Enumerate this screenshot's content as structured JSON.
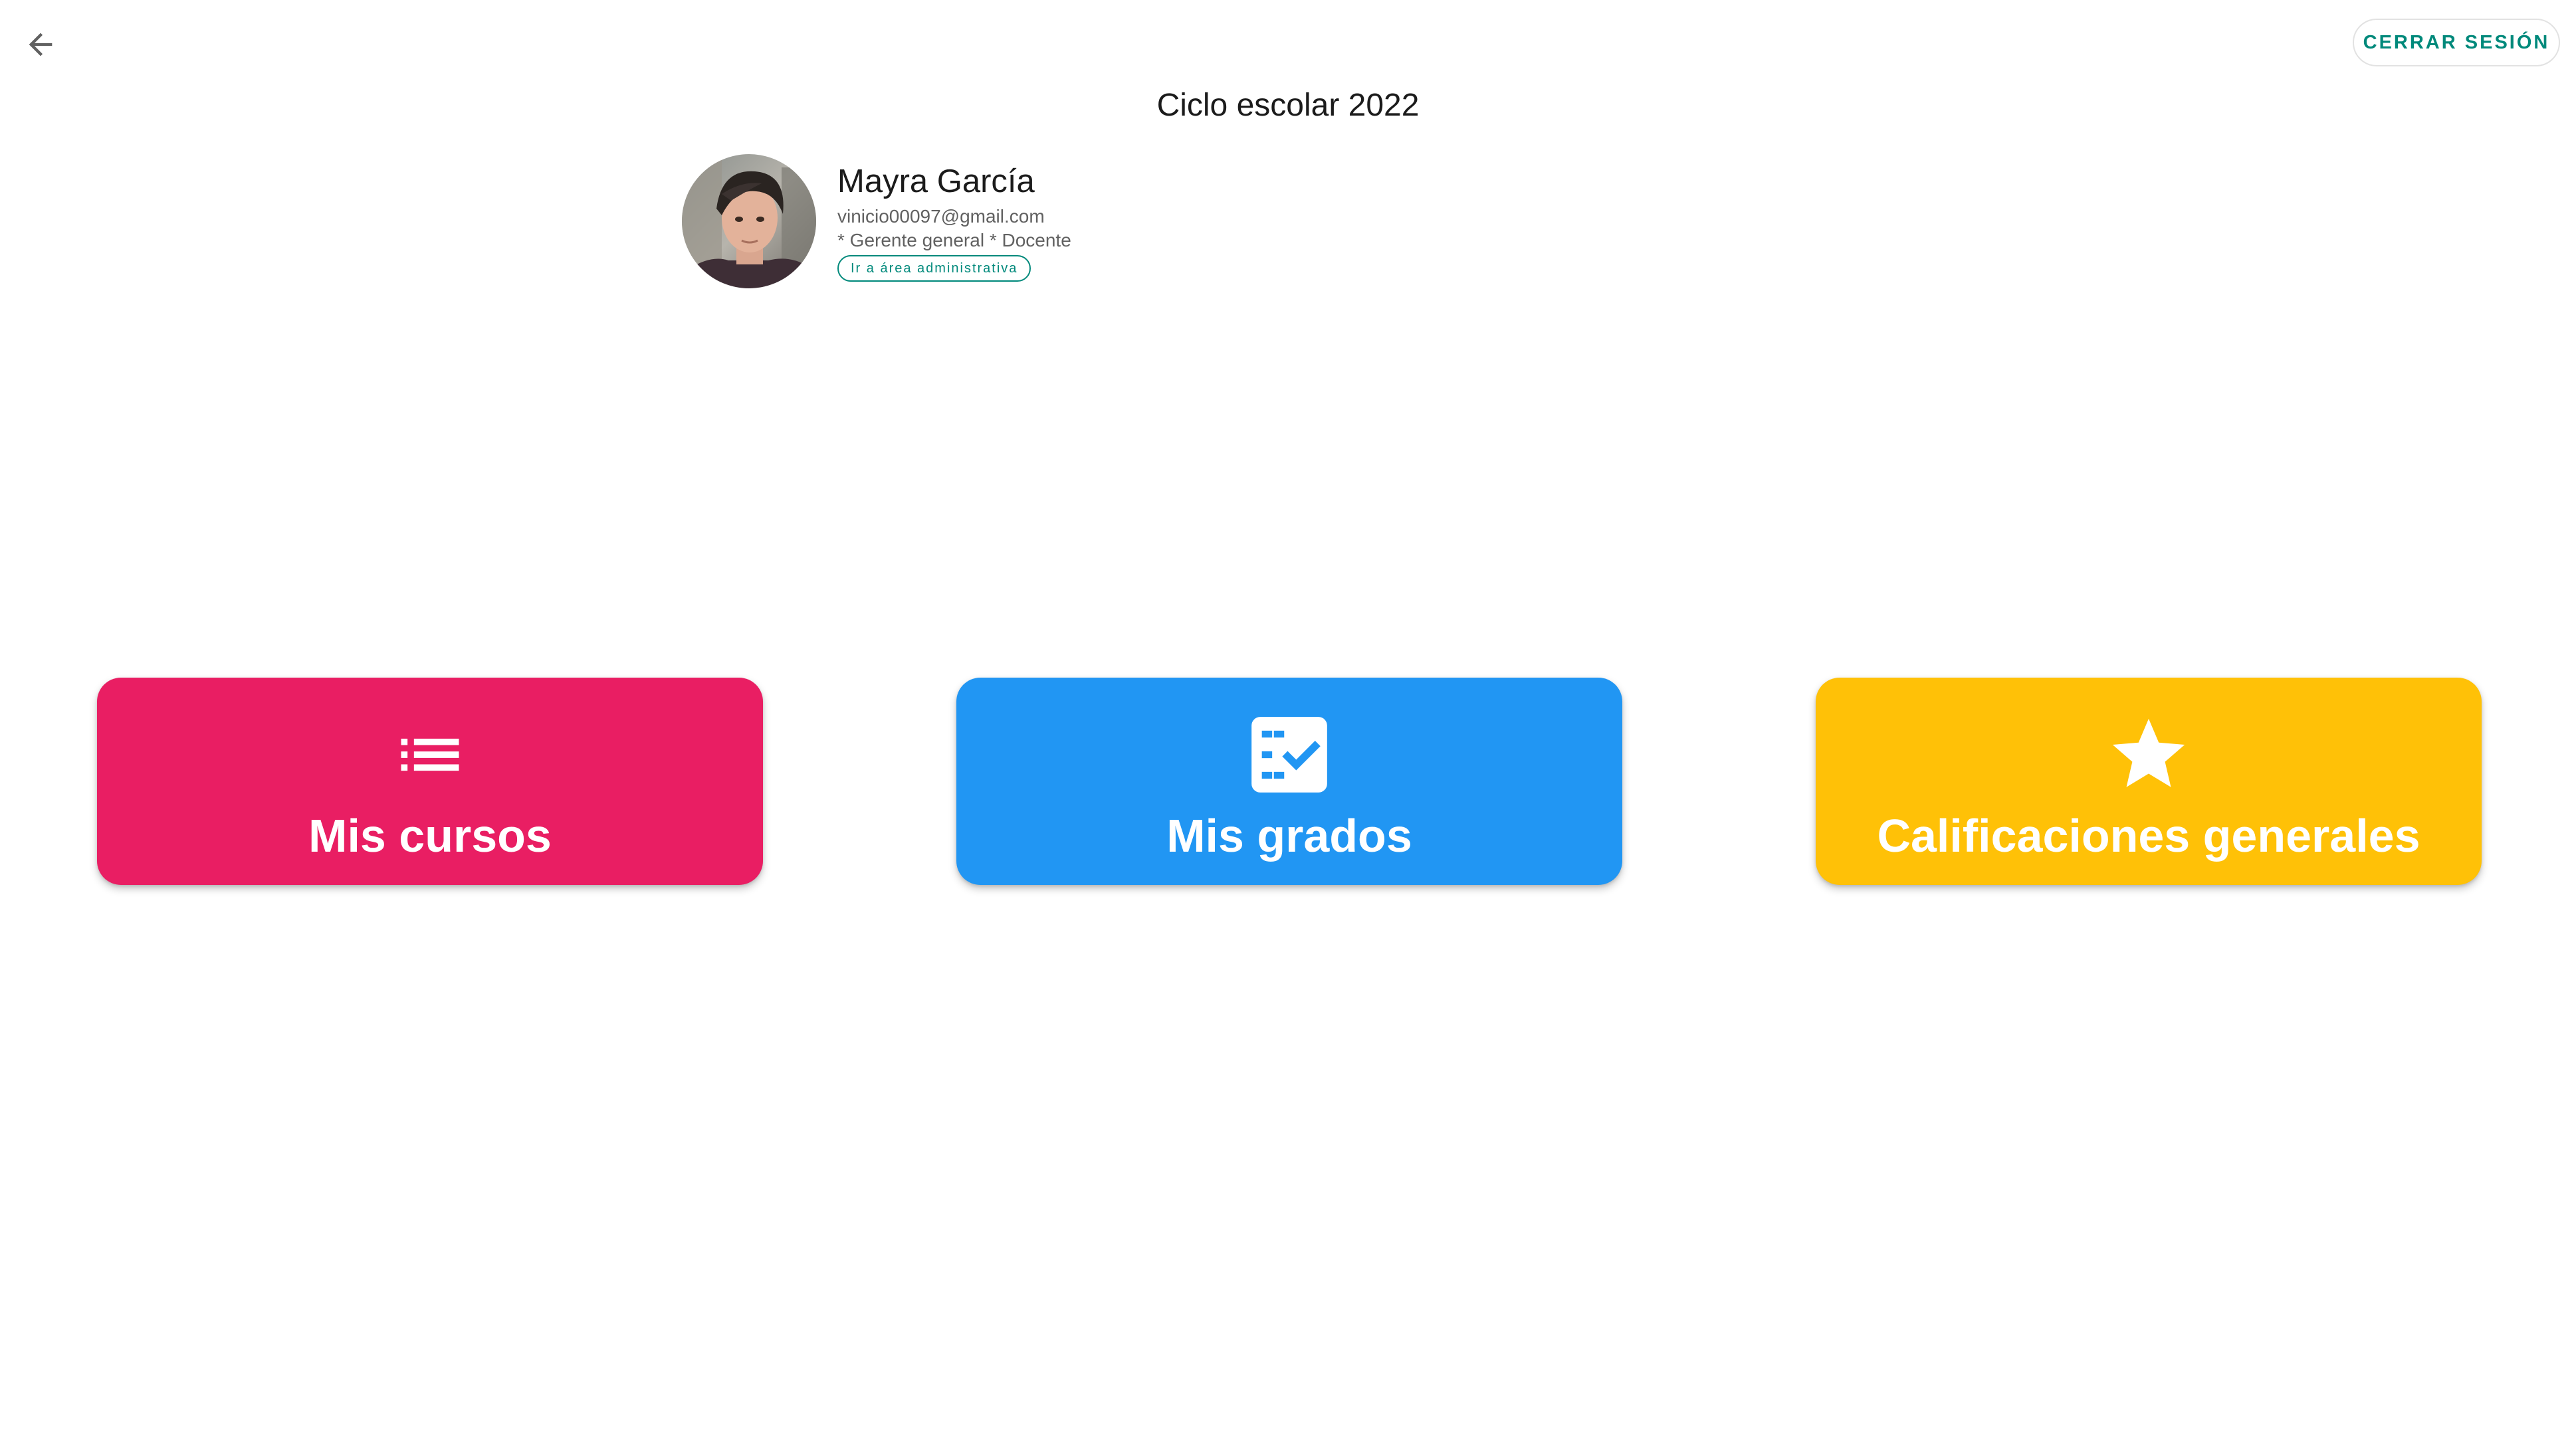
{
  "header": {
    "back_icon": "arrow-left-icon",
    "logout_label": "CERRAR SESIÓN",
    "title": "Ciclo escolar 2022"
  },
  "profile": {
    "name": "Mayra García",
    "email": "vinicio00097@gmail.com",
    "roles": "* Gerente general * Docente",
    "admin_link": "Ir a área administrativa"
  },
  "cards": [
    {
      "label": "Mis cursos",
      "icon": "list-icon",
      "color": "#e91e63"
    },
    {
      "label": "Mis grados",
      "icon": "checklist-icon",
      "color": "#2196f3"
    },
    {
      "label": "Calificaciones generales",
      "icon": "star-icon",
      "color": "#ffc107"
    }
  ],
  "colors": {
    "accent": "#00897b",
    "text_primary": "#1b1b1b",
    "text_secondary": "#616161"
  }
}
